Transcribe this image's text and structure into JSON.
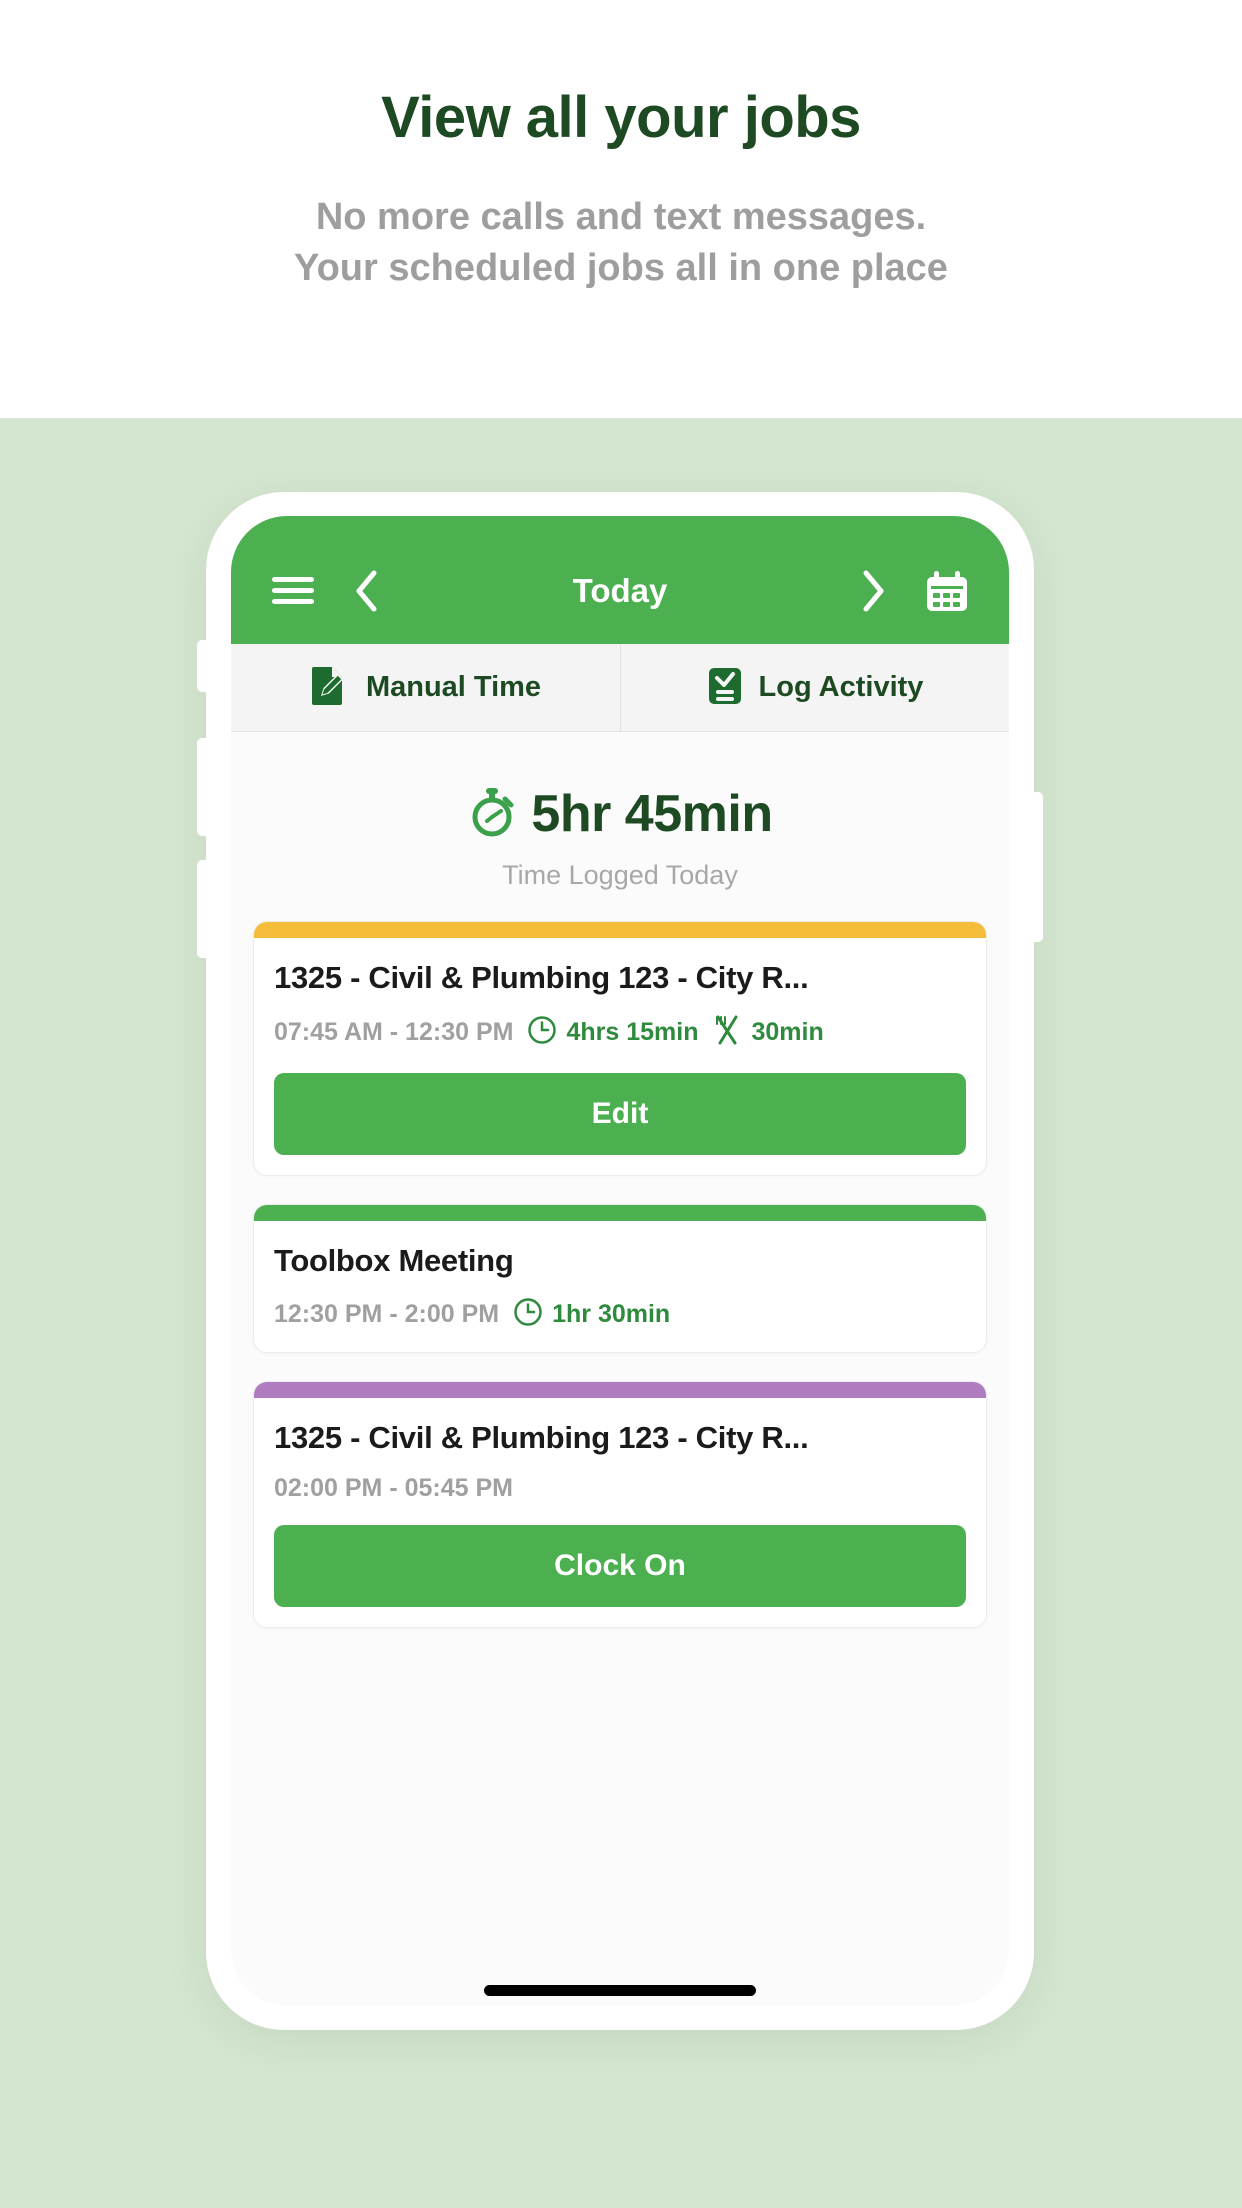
{
  "promo": {
    "title": "View all your jobs",
    "subtitle_line1": "No more calls and text messages.",
    "subtitle_line2": "Your scheduled jobs all in one place"
  },
  "colors": {
    "brand_green": "#4caf50",
    "dark_green": "#1d4a22",
    "backdrop_green": "#d4e6d0",
    "accent_amber": "#f5bc3a",
    "accent_purple": "#b07cc0",
    "muted_grey": "#a0a0a0"
  },
  "app": {
    "navbar": {
      "menu_icon": "hamburger-menu-icon",
      "prev_icon": "chevron-left-icon",
      "title": "Today",
      "next_icon": "chevron-right-icon",
      "calendar_icon": "calendar-icon"
    },
    "tabs": [
      {
        "label": "Manual Time",
        "icon": "document-pencil-icon"
      },
      {
        "label": "Log Activity",
        "icon": "clipboard-check-icon"
      }
    ],
    "summary": {
      "icon": "stopwatch-icon",
      "time": "5hr 45min",
      "caption": "Time Logged Today"
    },
    "cards": [
      {
        "stripe_color": "#f5bc3a",
        "title": "1325 - Civil & Plumbing 123 - City R...",
        "times": "07:45 AM - 12:30 PM",
        "duration_icon": "clock-icon",
        "duration": "4hrs 15min",
        "break_icon": "cutlery-icon",
        "break": "30min",
        "action_label": "Edit"
      },
      {
        "stripe_color": "#4caf50",
        "title": "Toolbox Meeting",
        "times": "12:30 PM - 2:00 PM",
        "duration_icon": "clock-icon",
        "duration": "1hr 30min",
        "break_icon": "",
        "break": "",
        "action_label": ""
      },
      {
        "stripe_color": "#b07cc0",
        "title": "1325 - Civil & Plumbing 123 - City R...",
        "times": "02:00 PM - 05:45 PM",
        "duration_icon": "",
        "duration": "",
        "break_icon": "",
        "break": "",
        "action_label": "Clock On"
      }
    ],
    "home_indicator": "home-indicator-bar"
  }
}
